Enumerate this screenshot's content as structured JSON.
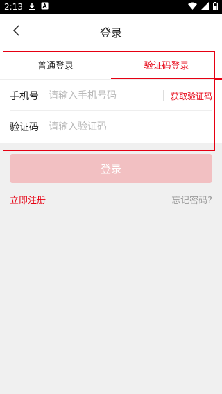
{
  "status_bar": {
    "time": "2:13",
    "icons": [
      "download-icon",
      "a-badge-icon",
      "wifi-icon",
      "signal-icon",
      "battery-icon"
    ]
  },
  "header": {
    "title": "登录",
    "back_icon": "chevron-left-icon"
  },
  "tabs": [
    {
      "label": "普通登录",
      "active": false
    },
    {
      "label": "验证码登录",
      "active": true
    }
  ],
  "form": {
    "phone": {
      "label": "手机号",
      "placeholder": "请输入手机号码",
      "value": ""
    },
    "get_code_label": "获取验证码",
    "code": {
      "label": "验证码",
      "placeholder": "请输入验证码",
      "value": ""
    }
  },
  "login_button": "登录",
  "register_link": "立即注册",
  "forgot_link": "忘记密码?",
  "colors": {
    "accent": "#e60012",
    "button_disabled": "#f2c0c2",
    "background": "#f0f0f0"
  }
}
